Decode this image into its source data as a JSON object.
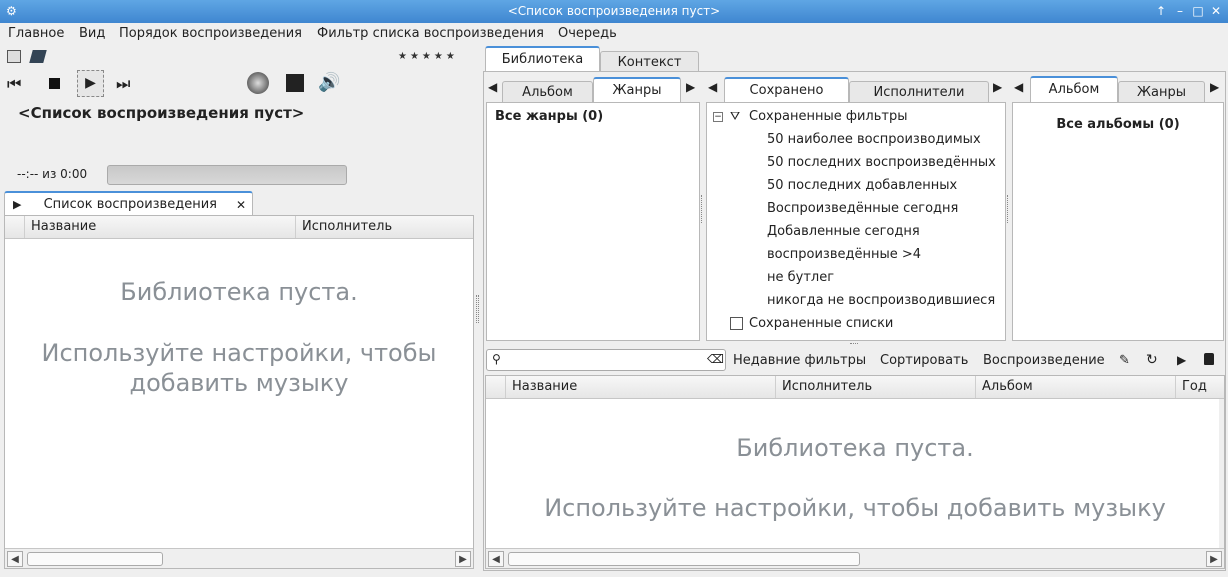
{
  "window": {
    "title": "<Список воспроизведения пуст>"
  },
  "menu": [
    "Главное",
    "Вид",
    "Порядок воспроизведения",
    "Фильтр списка воспроизведения",
    "Очередь"
  ],
  "player": {
    "now_playing": "<Список воспроизведения пуст>",
    "time": "--:-- из 0:00",
    "rating_stars": "★★★★★",
    "progress": 0
  },
  "playlist": {
    "tab_label": "Список воспроизведения",
    "columns": [
      "Название",
      "Исполнитель"
    ],
    "empty_line1": "Библиотека пуста.",
    "empty_line2": "Используйте настройки, чтобы добавить музыку"
  },
  "library": {
    "tabs": [
      "Библиотека",
      "Контекст"
    ],
    "left_subtabs": [
      "Альбом",
      "Жанры"
    ],
    "genres_header": "Все жанры (0)",
    "middle_subtabs": [
      "Сохранено",
      "Исполнители"
    ],
    "saved_filters_title": "Сохраненные фильтры",
    "saved_filters": [
      "50 наиболее воспроизводимых",
      "50 последних воспроизведённых",
      "50 последних добавленных",
      "Воспроизведённые сегодня",
      "Добавленные сегодня",
      "воспроизведённые >4",
      "не бутлег",
      "никогда не воспроизводившиеся"
    ],
    "saved_lists_title": "Сохраненные списки",
    "right_subtabs": [
      "Альбом",
      "Жанры"
    ],
    "albums_header": "Все альбомы (0)",
    "search_placeholder": "",
    "toolbar": {
      "recent": "Недавние фильтры",
      "sort": "Сортировать",
      "playback": "Воспроизведение"
    },
    "columns": [
      "Название",
      "Исполнитель",
      "Альбом",
      "Год"
    ],
    "empty_line1": "Библиотека пуста.",
    "empty_line2": "Используйте настройки, чтобы добавить музыку"
  }
}
